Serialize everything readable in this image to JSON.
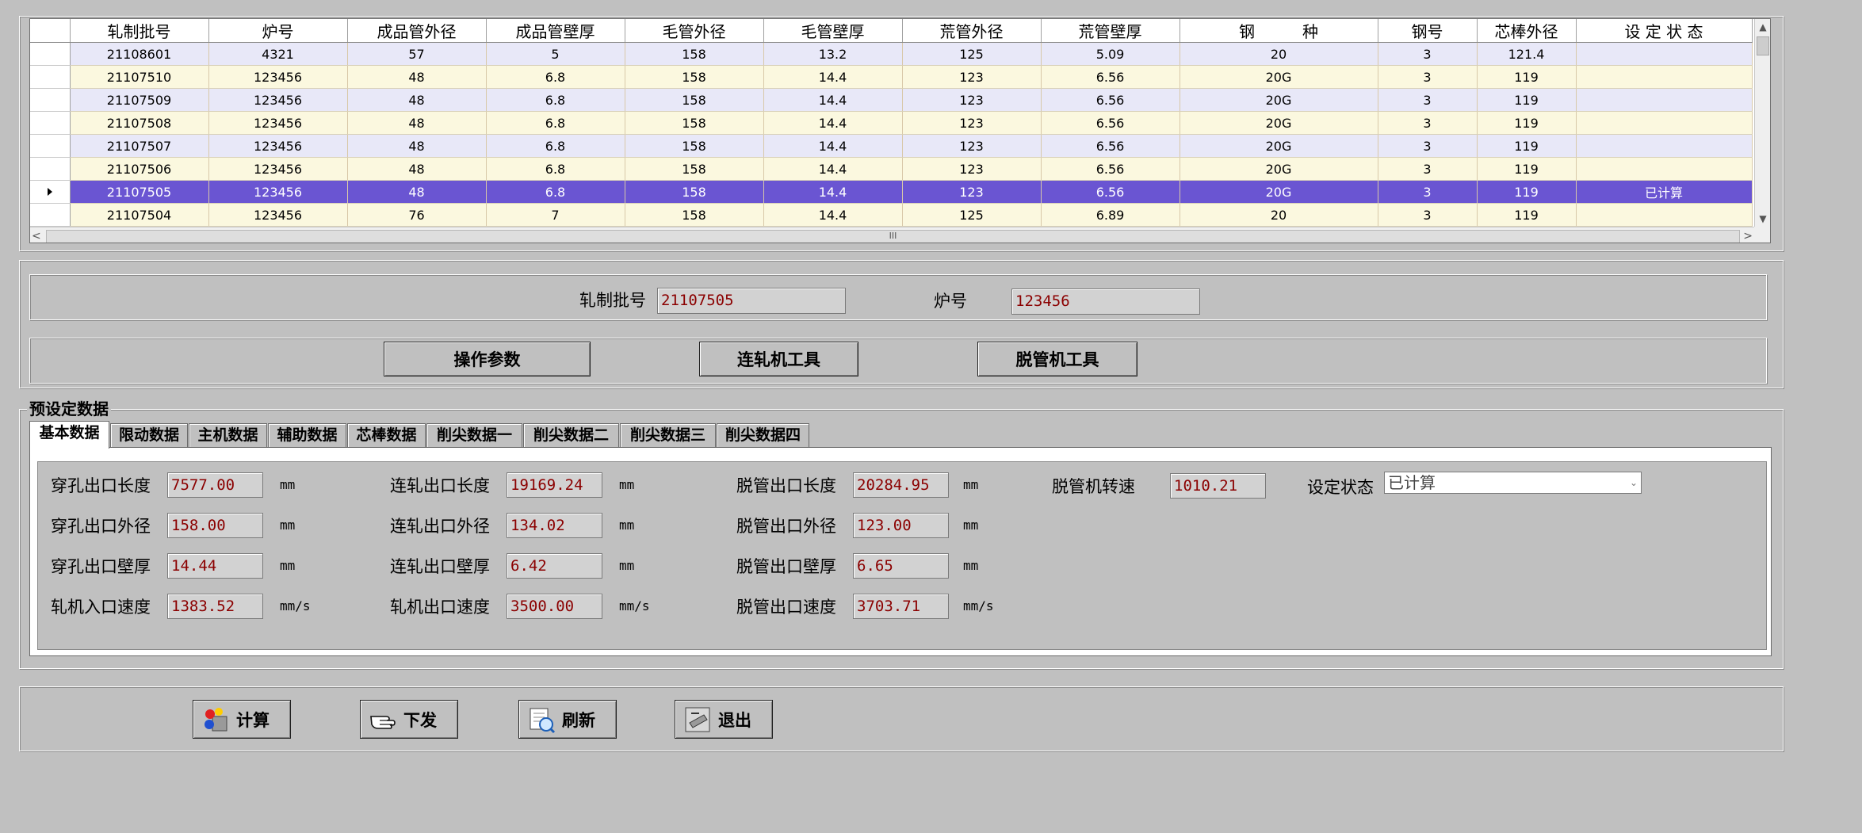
{
  "grid": {
    "headers": [
      "轧制批号",
      "炉号",
      "成品管外径",
      "成品管壁厚",
      "毛管外径",
      "毛管壁厚",
      "荒管外径",
      "荒管壁厚",
      "钢　　　种",
      "钢号",
      "芯棒外径",
      "设 定 状 态"
    ],
    "rows": [
      [
        "21108601",
        "4321",
        "57",
        "5",
        "158",
        "13.2",
        "125",
        "5.09",
        "20",
        "3",
        "121.4",
        ""
      ],
      [
        "21107510",
        "123456",
        "48",
        "6.8",
        "158",
        "14.4",
        "123",
        "6.56",
        "20G",
        "3",
        "119",
        ""
      ],
      [
        "21107509",
        "123456",
        "48",
        "6.8",
        "158",
        "14.4",
        "123",
        "6.56",
        "20G",
        "3",
        "119",
        ""
      ],
      [
        "21107508",
        "123456",
        "48",
        "6.8",
        "158",
        "14.4",
        "123",
        "6.56",
        "20G",
        "3",
        "119",
        ""
      ],
      [
        "21107507",
        "123456",
        "48",
        "6.8",
        "158",
        "14.4",
        "123",
        "6.56",
        "20G",
        "3",
        "119",
        ""
      ],
      [
        "21107506",
        "123456",
        "48",
        "6.8",
        "158",
        "14.4",
        "123",
        "6.56",
        "20G",
        "3",
        "119",
        ""
      ],
      [
        "21107505",
        "123456",
        "48",
        "6.8",
        "158",
        "14.4",
        "123",
        "6.56",
        "20G",
        "3",
        "119",
        "已计算"
      ],
      [
        "21107504",
        "123456",
        "76",
        "7",
        "158",
        "14.4",
        "125",
        "6.89",
        "20",
        "3",
        "119",
        ""
      ]
    ],
    "selected_row": 6,
    "scroll": {
      "up": "▲",
      "down": "▼",
      "left": "<",
      "right": ">",
      "thumb": "III"
    }
  },
  "info": {
    "batch_label": "轧制批号",
    "batch_value": "21107505",
    "heat_label": "炉号",
    "heat_value": "123456"
  },
  "actions": {
    "op_params": "操作参数",
    "mill_tools": "连轧机工具",
    "extractor_tools": "脱管机工具"
  },
  "preset": {
    "title": "预设定数据",
    "tabs": [
      "基本数据",
      "限动数据",
      "主机数据",
      "辅助数据",
      "芯棒数据",
      "削尖数据一",
      "削尖数据二",
      "削尖数据三",
      "削尖数据四"
    ],
    "active_tab": 0,
    "col1": [
      {
        "label": "穿孔出口长度",
        "value": "7577.00",
        "unit": "mm"
      },
      {
        "label": "穿孔出口外径",
        "value": "158.00",
        "unit": "mm"
      },
      {
        "label": "穿孔出口壁厚",
        "value": "14.44",
        "unit": "mm"
      },
      {
        "label": "轧机入口速度",
        "value": "1383.52",
        "unit": "mm/s"
      }
    ],
    "col2": [
      {
        "label": "连轧出口长度",
        "value": "19169.24",
        "unit": "mm"
      },
      {
        "label": "连轧出口外径",
        "value": "134.02",
        "unit": "mm"
      },
      {
        "label": "连轧出口壁厚",
        "value": "6.42",
        "unit": "mm"
      },
      {
        "label": "轧机出口速度",
        "value": "3500.00",
        "unit": "mm/s"
      }
    ],
    "col3": [
      {
        "label": "脱管出口长度",
        "value": "20284.95",
        "unit": "mm"
      },
      {
        "label": "脱管出口外径",
        "value": "123.00",
        "unit": "mm"
      },
      {
        "label": "脱管出口壁厚",
        "value": "6.65",
        "unit": "mm"
      },
      {
        "label": "脱管出口速度",
        "value": "3703.71",
        "unit": "mm/s"
      }
    ],
    "speed": {
      "label": "脱管机转速",
      "value": "1010.21"
    },
    "status": {
      "label": "设定状态",
      "value": "已计算"
    }
  },
  "toolbar": {
    "calc": "计算",
    "download": "下发",
    "refresh": "刷新",
    "exit": "退出"
  },
  "colors": {
    "selected_row": "#6a55d2",
    "row_odd": "#e8e8f8",
    "row_even": "#fbf8df",
    "value_text": "#8b0000"
  }
}
